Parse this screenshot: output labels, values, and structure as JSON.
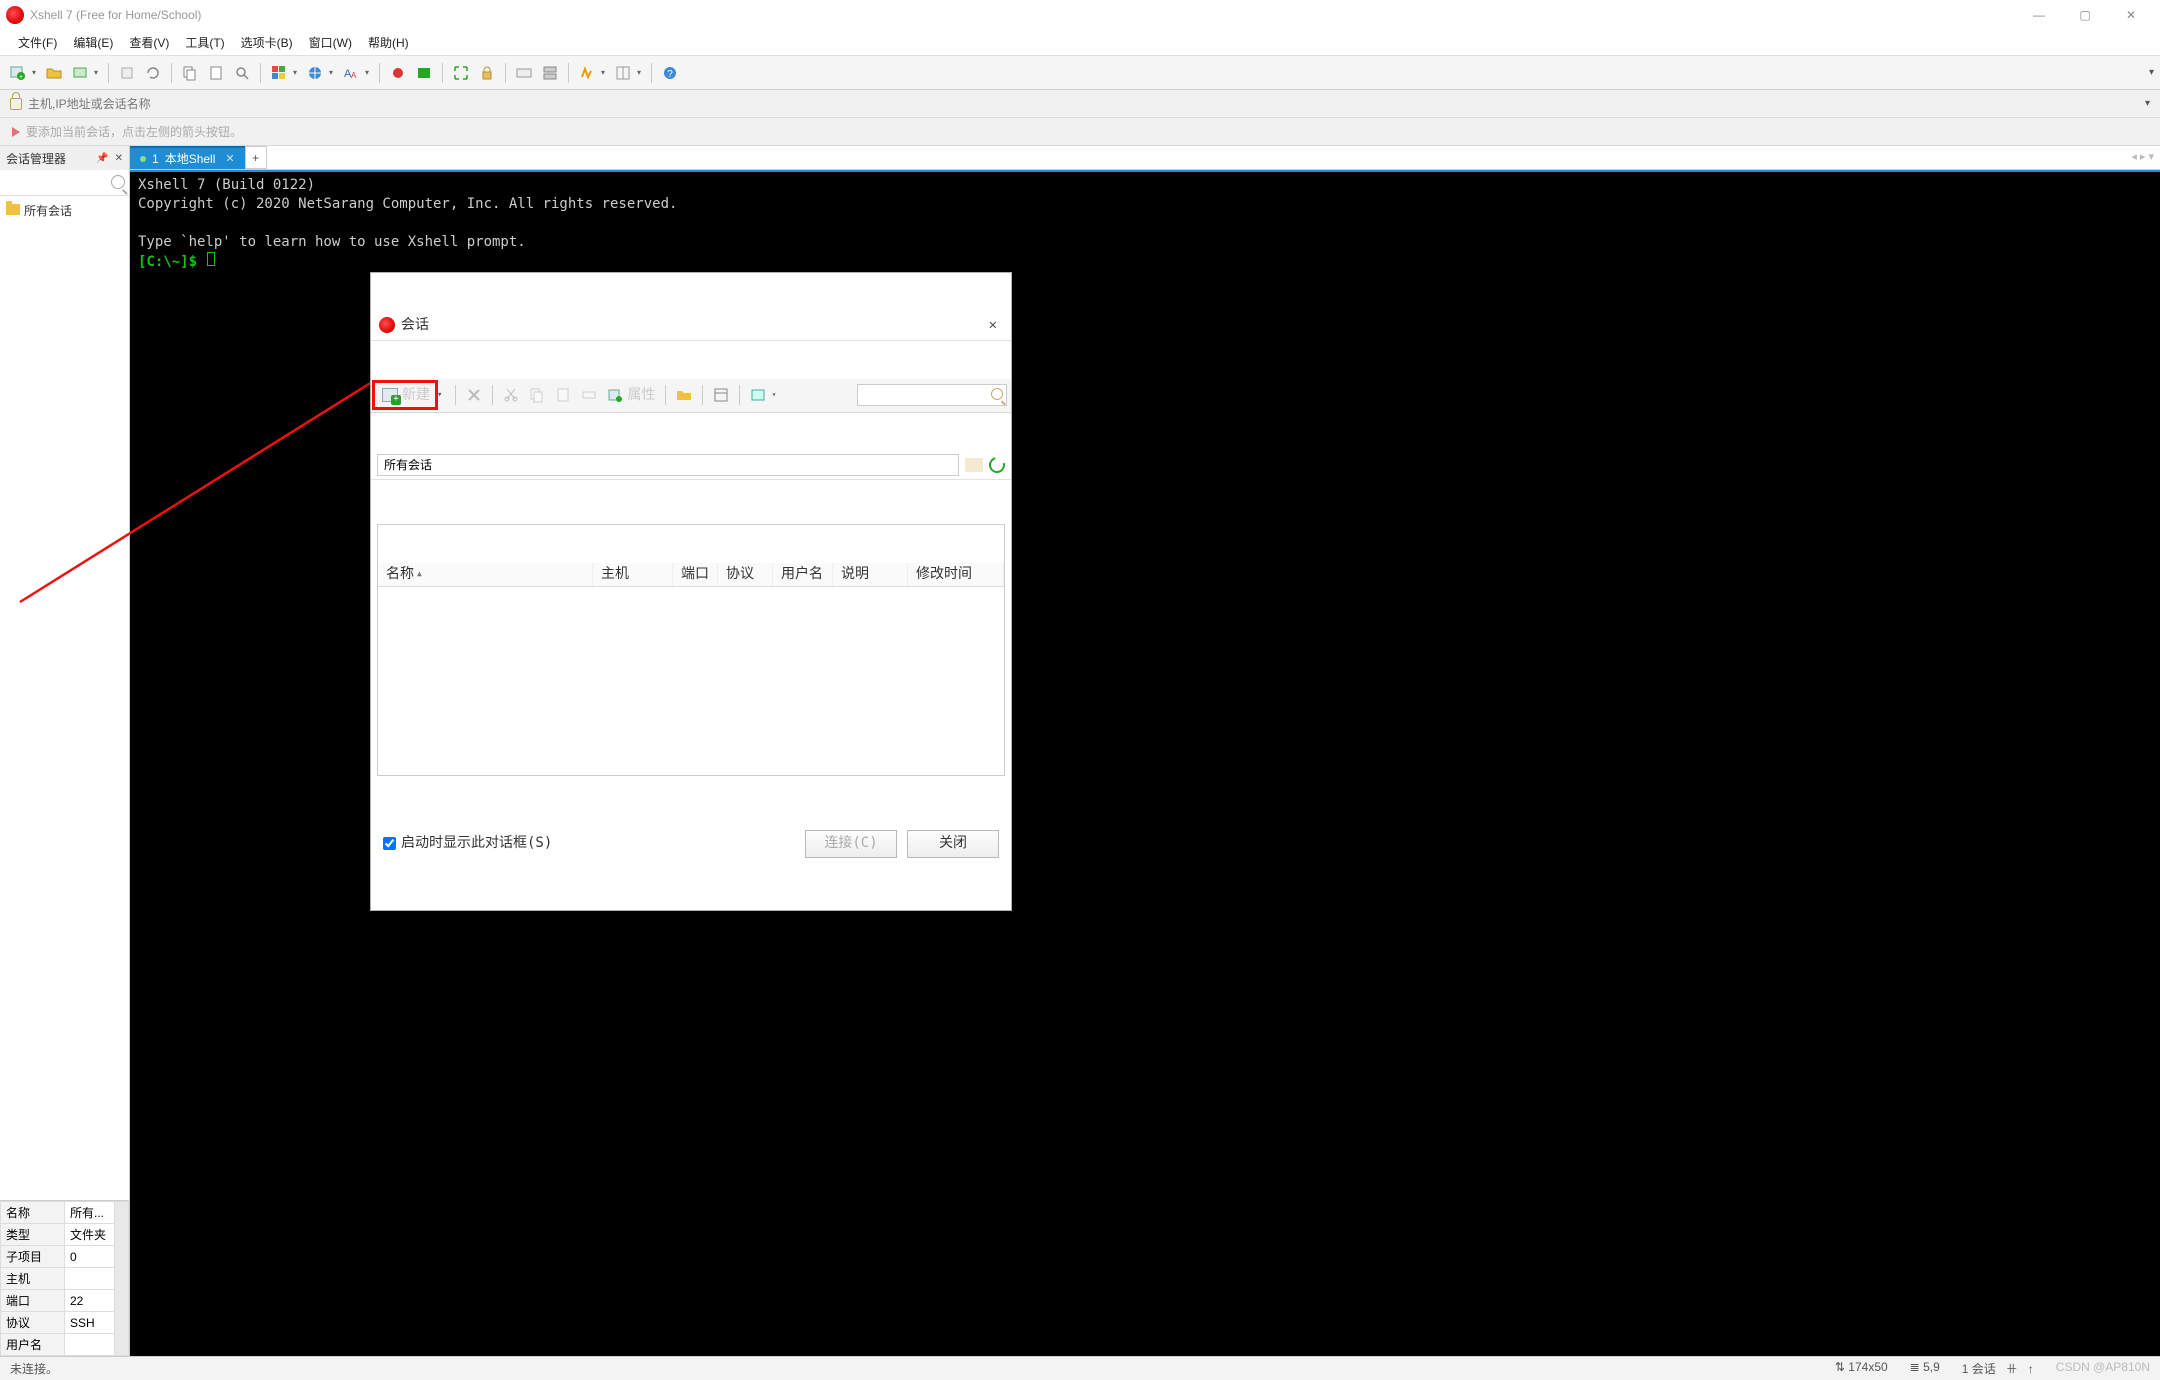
{
  "window": {
    "title": "Xshell 7 (Free for Home/School)"
  },
  "menu": {
    "items": [
      "文件(F)",
      "编辑(E)",
      "查看(V)",
      "工具(T)",
      "选项卡(B)",
      "窗口(W)",
      "帮助(H)"
    ]
  },
  "addrbar": {
    "placeholder": "主机,IP地址或会话名称"
  },
  "hintbar": {
    "text": "要添加当前会话，点击左侧的箭头按钮。"
  },
  "session_manager": {
    "title": "会话管理器",
    "tree_root": "所有会话",
    "props": [
      {
        "k": "名称",
        "v": "所有..."
      },
      {
        "k": "类型",
        "v": "文件夹"
      },
      {
        "k": "子项目",
        "v": "0"
      },
      {
        "k": "主机",
        "v": ""
      },
      {
        "k": "端口",
        "v": "22"
      },
      {
        "k": "协议",
        "v": "SSH"
      },
      {
        "k": "用户名",
        "v": ""
      }
    ]
  },
  "tab": {
    "index": "1",
    "label": "本地Shell"
  },
  "terminal": {
    "line1": "Xshell 7 (Build 0122)",
    "line2": "Copyright (c) 2020 NetSarang Computer, Inc. All rights reserved.",
    "line3": "Type `help' to learn how to use Xshell prompt.",
    "prompt": "[C:\\~]$ "
  },
  "dialog": {
    "title": "会话",
    "new_label": "新建",
    "props_label": "属性",
    "path_value": "所有会话",
    "columns": [
      "名称",
      "主机",
      "端口",
      "协议",
      "用户名",
      "说明",
      "修改时间"
    ],
    "show_on_startup": "启动时显示此对话框(S)",
    "connect": "连接(C)",
    "close": "关闭"
  },
  "status": {
    "left": "未连接。",
    "size": "174x50",
    "cursor": "5,9",
    "sessions": "1 会话",
    "watermark": "CSDN @AP810N"
  }
}
